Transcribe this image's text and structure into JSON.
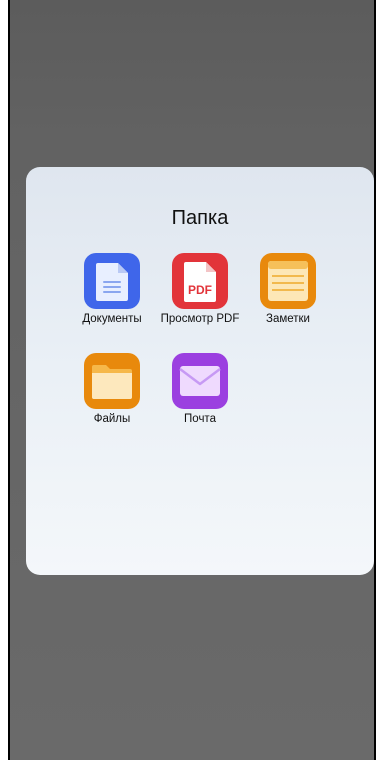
{
  "folder": {
    "title": "Папка",
    "apps": [
      {
        "label": "Документы",
        "icon": "documents-icon",
        "color": "#3f66ea"
      },
      {
        "label": "Просмотр PDF",
        "icon": "pdf-viewer-icon",
        "color": "#e2343a",
        "badge": "PDF"
      },
      {
        "label": "Заметки",
        "icon": "notes-icon",
        "color": "#e8890c"
      },
      {
        "label": "Файлы",
        "icon": "files-folder-icon",
        "color": "#e8890c"
      },
      {
        "label": "Почта",
        "icon": "mail-envelope-icon",
        "color": "#9b3fe0"
      }
    ]
  }
}
